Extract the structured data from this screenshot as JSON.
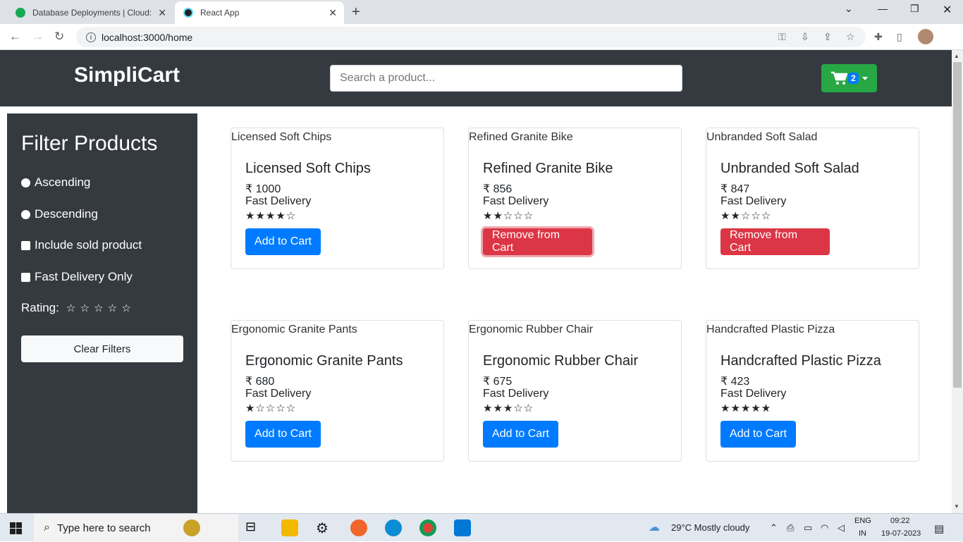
{
  "browser": {
    "tabs": [
      {
        "title": "Database Deployments | Cloud: M"
      },
      {
        "title": "React App"
      }
    ],
    "url": "localhost:3000/home"
  },
  "header": {
    "brand": "SimpliCart",
    "search_placeholder": "Search a product...",
    "cart_count": "2"
  },
  "filters": {
    "title": "Filter Products",
    "ascending": "Ascending",
    "descending": "Descending",
    "include_sold": "Include sold product",
    "fast_delivery": "Fast Delivery Only",
    "rating_label": "Rating:",
    "rating_value": 0,
    "clear_label": "Clear Filters"
  },
  "products": [
    {
      "name": "Licensed Soft Chips",
      "price": "₹ 1000",
      "delivery": "Fast Delivery",
      "rating": 4,
      "button": "Add to Cart",
      "in_cart": false
    },
    {
      "name": "Refined Granite Bike",
      "price": "₹ 856",
      "delivery": "Fast Delivery",
      "rating": 2,
      "button": "Remove from Cart",
      "in_cart": true
    },
    {
      "name": "Unbranded Soft Salad",
      "price": "₹ 847",
      "delivery": "Fast Delivery",
      "rating": 2,
      "button": "Remove from Cart",
      "in_cart": true
    },
    {
      "name": "Ergonomic Granite Pants",
      "price": "₹ 680",
      "delivery": "Fast Delivery",
      "rating": 1,
      "button": "Add to Cart",
      "in_cart": false
    },
    {
      "name": "Ergonomic Rubber Chair",
      "price": "₹ 675",
      "delivery": "Fast Delivery",
      "rating": 3,
      "button": "Add to Cart",
      "in_cart": false
    },
    {
      "name": "Handcrafted Plastic Pizza",
      "price": "₹ 423",
      "delivery": "Fast Delivery",
      "rating": 5,
      "button": "Add to Cart",
      "in_cart": false
    }
  ],
  "taskbar": {
    "search_placeholder": "Type here to search",
    "weather": "29°C  Mostly cloudy",
    "lang_top": "ENG",
    "lang_bottom": "IN",
    "time": "09:22",
    "date": "19-07-2023"
  },
  "colors": {
    "navbar": "#343a40",
    "cart_button": "#28a745",
    "primary": "#007bff",
    "danger": "#dc3545"
  }
}
